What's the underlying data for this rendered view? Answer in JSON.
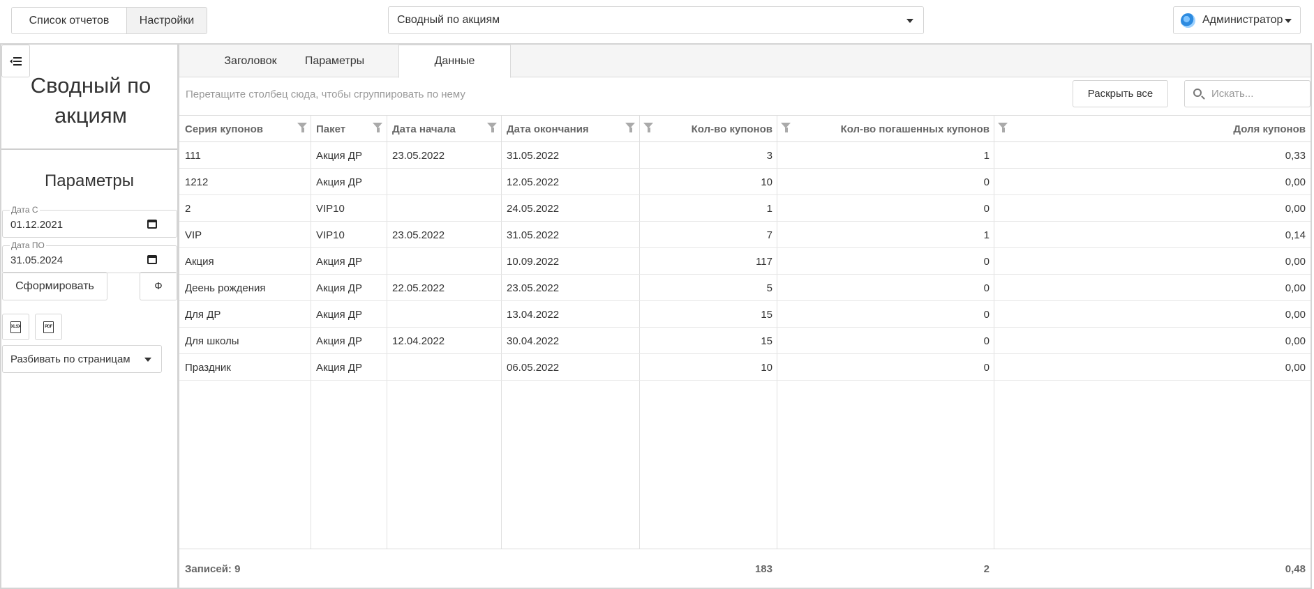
{
  "topbar": {
    "reports_button": "Список отчетов",
    "settings_button": "Настройки",
    "report_select": "Сводный по акциям",
    "user": "Администратор"
  },
  "sidebar": {
    "title": "Сводный по акциям",
    "params_title": "Параметры",
    "date_from": {
      "label": "Дата С",
      "value": "01.12.2021"
    },
    "date_to": {
      "label": "Дата ПО",
      "value": "31.05.2024"
    },
    "generate_button": "Сформировать",
    "phi_button": "Ф",
    "xlsx_label": "XLSX",
    "pdf_label": "PDF",
    "paging_select": "Разбивать по страницам"
  },
  "tabs": [
    {
      "label": "Заголовок"
    },
    {
      "label": "Параметры"
    },
    {
      "label": "Данные"
    }
  ],
  "group_hint": "Перетащите столбец сюда, чтобы сгруппировать по нему",
  "expand_all_button": "Раскрыть все",
  "search_placeholder": "Искать...",
  "columns": [
    "Серия купонов",
    "Пакет",
    "Дата начала",
    "Дата окончания",
    "Кол-во купонов",
    "Кол-во погашенных купонов",
    "Доля купонов"
  ],
  "rows": [
    [
      "111",
      "Акция ДР",
      "23.05.2022",
      "31.05.2022",
      "3",
      "1",
      "0,33"
    ],
    [
      "1212",
      "Акция ДР",
      "",
      "12.05.2022",
      "10",
      "0",
      "0,00"
    ],
    [
      "2",
      "VIP10",
      "",
      "24.05.2022",
      "1",
      "0",
      "0,00"
    ],
    [
      "VIP",
      "VIP10",
      "23.05.2022",
      "31.05.2022",
      "7",
      "1",
      "0,14"
    ],
    [
      "Акция",
      "Акция ДР",
      "",
      "10.09.2022",
      "117",
      "0",
      "0,00"
    ],
    [
      "Деень рождения",
      "Акция ДР",
      "22.05.2022",
      "23.05.2022",
      "5",
      "0",
      "0,00"
    ],
    [
      "Для ДР",
      "Акция ДР",
      "",
      "13.04.2022",
      "15",
      "0",
      "0,00"
    ],
    [
      "Для школы",
      "Акция ДР",
      "12.04.2022",
      "30.04.2022",
      "15",
      "0",
      "0,00"
    ],
    [
      "Праздник",
      "Акция ДР",
      "",
      "06.05.2022",
      "10",
      "0",
      "0,00"
    ]
  ],
  "footer": {
    "records": "Записей: 9",
    "total_coupons": "183",
    "total_redeemed": "2",
    "total_share": "0,48"
  }
}
